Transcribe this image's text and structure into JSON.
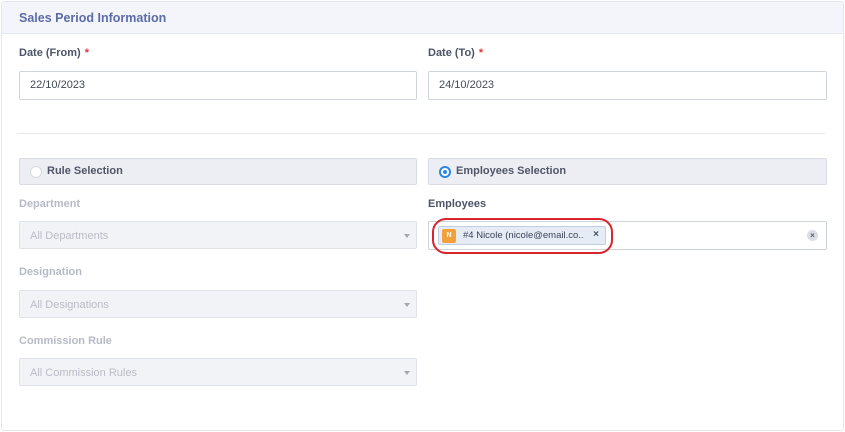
{
  "section": {
    "title": "Sales Period Information"
  },
  "date_from": {
    "label": "Date (From)",
    "required_mark": "*",
    "value": "22/10/2023"
  },
  "date_to": {
    "label": "Date (To)",
    "required_mark": "*",
    "value": "24/10/2023"
  },
  "selection_mode": {
    "rule_label": "Rule Selection",
    "employees_label": "Employees Selection",
    "selected": "employees"
  },
  "department": {
    "label": "Department",
    "placeholder": "All Departments"
  },
  "designation": {
    "label": "Designation",
    "placeholder": "All Designations"
  },
  "commission_rule": {
    "label": "Commission Rule",
    "placeholder": "All Commission Rules"
  },
  "employees": {
    "label": "Employees",
    "chips": [
      {
        "avatar_letter": "N",
        "text": "#4 Nicole (nicole@email.co...",
        "remove": "×"
      }
    ],
    "clear_all": "×"
  },
  "colors": {
    "accent": "#2b86e3",
    "title": "#5c6ba8",
    "required": "#e0343b",
    "avatar": "#f2a13a",
    "highlight": "#d9232e"
  }
}
